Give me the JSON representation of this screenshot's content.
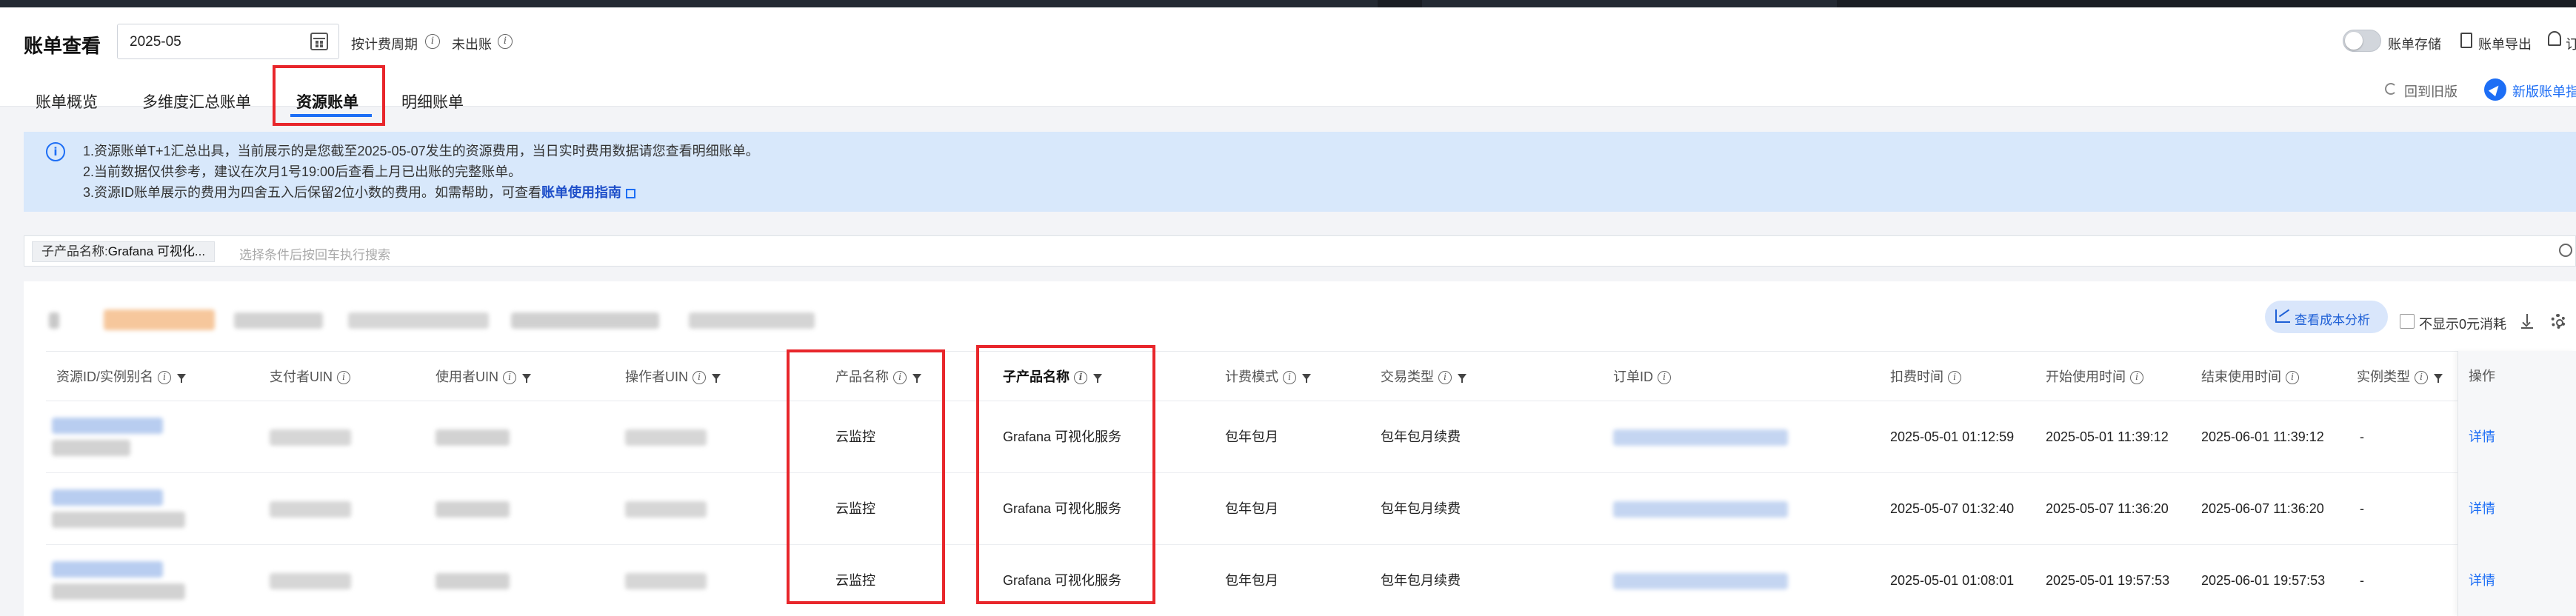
{
  "header": {
    "title": "账单查看",
    "month": "2025-05",
    "billing_period_label": "按计费周期",
    "bill_status": "未出账",
    "bill_storage_label": "账单存储",
    "bill_export_label": "账单导出",
    "subscribe_label_partial": "订"
  },
  "tabs": [
    {
      "label": "账单概览"
    },
    {
      "label": "多维度汇总账单"
    },
    {
      "label": "资源账单"
    },
    {
      "label": "明细账单"
    }
  ],
  "actions": {
    "back_to_old": "回到旧版",
    "new_bill": "新版账单指"
  },
  "notice": {
    "line1": "1.资源账单T+1汇总出具，当前展示的是您截至2025-05-07发生的资源费用，当日实时费用数据请您查看明细账单。",
    "line2": "2.当前数据仅供参考，建议在次月1号19:00后查看上月已出账的完整账单。",
    "line3_prefix": "3.资源ID账单展示的费用为四舍五入后保留2位小数的费用。如需帮助，可查看",
    "line3_link": "账单使用指南"
  },
  "filter": {
    "tag_key": "子产品名称:",
    "tag_value": "Grafana 可视化...",
    "placeholder": "选择条件后按回车执行搜索"
  },
  "toolbar": {
    "cost_analysis": "查看成本分析",
    "hide_zero_label": "不显示0元消耗"
  },
  "table": {
    "headers": {
      "resource_id": "资源ID/实例别名",
      "payer_uin": "支付者UIN",
      "user_uin": "使用者UIN",
      "operator_uin": "操作者UIN",
      "product": "产品名称",
      "sub_product": "子产品名称",
      "billing_mode": "计费模式",
      "trade_type": "交易类型",
      "order_id": "订单ID",
      "deduct_time": "扣费时间",
      "start_time": "开始使用时间",
      "end_time": "结束使用时间",
      "instance_type": "实例类型",
      "ops": "操作"
    },
    "rows": [
      {
        "product": "云监控",
        "sub_product": "Grafana 可视化服务",
        "billing_mode": "包年包月",
        "trade_type": "包年包月续费",
        "deduct_time": "2025-05-01 01:12:59",
        "start_time": "2025-05-01 11:39:12",
        "end_time": "2025-06-01 11:39:12",
        "instance_type": "-",
        "ops": "详情"
      },
      {
        "product": "云监控",
        "sub_product": "Grafana 可视化服务",
        "billing_mode": "包年包月",
        "trade_type": "包年包月续费",
        "deduct_time": "2025-05-07 01:32:40",
        "start_time": "2025-05-07 11:36:20",
        "end_time": "2025-06-07 11:36:20",
        "instance_type": "-",
        "ops": "详情"
      },
      {
        "product": "云监控",
        "sub_product": "Grafana 可视化服务",
        "billing_mode": "包年包月",
        "trade_type": "包年包月续费",
        "deduct_time": "2025-05-01 01:08:01",
        "start_time": "2025-05-01 19:57:53",
        "end_time": "2025-06-01 19:57:53",
        "instance_type": "-",
        "ops": "详情"
      }
    ]
  },
  "colors": {
    "primary": "#1d6ef5",
    "highlight": "#e8262b",
    "notice_bg": "#d8e8fb"
  }
}
